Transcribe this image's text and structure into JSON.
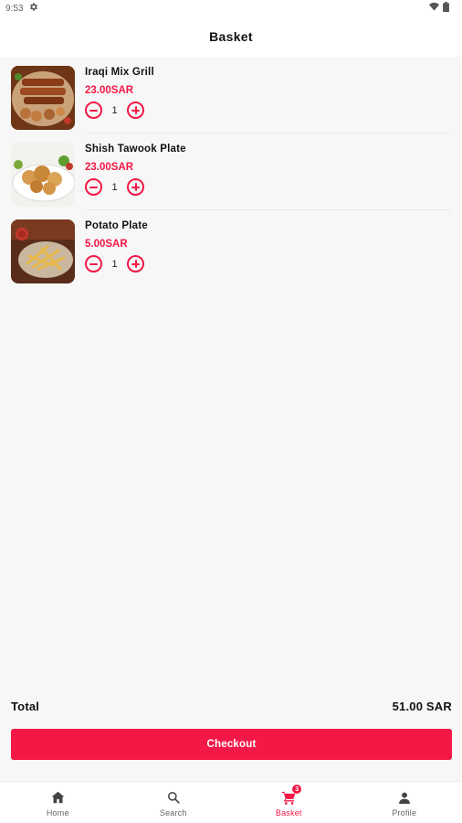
{
  "status_bar": {
    "time": "9:53"
  },
  "header": {
    "title": "Basket"
  },
  "items": [
    {
      "name": "Iraqi Mix Grill",
      "price": "23.00SAR",
      "quantity": "1",
      "image": "mixed-grill-photo"
    },
    {
      "name": "Shish Tawook Plate",
      "price": "23.00SAR",
      "quantity": "1",
      "image": "chicken-plate-photo"
    },
    {
      "name": "Potato Plate",
      "price": "5.00SAR",
      "quantity": "1",
      "image": "fries-photo"
    }
  ],
  "summary": {
    "total_label": "Total",
    "total_value": "51.00 SAR"
  },
  "checkout": {
    "label": "Checkout"
  },
  "nav": {
    "home": "Home",
    "search": "Search",
    "basket": "Basket",
    "basket_badge": "3",
    "profile": "Profile"
  },
  "colors": {
    "accent": "#f31846",
    "background": "#f7f7f7",
    "surface": "#ffffff"
  },
  "icons": [
    "settings-icon",
    "wifi-icon",
    "battery-icon",
    "minus-icon",
    "plus-icon",
    "home-icon",
    "search-icon",
    "cart-icon",
    "person-icon"
  ]
}
